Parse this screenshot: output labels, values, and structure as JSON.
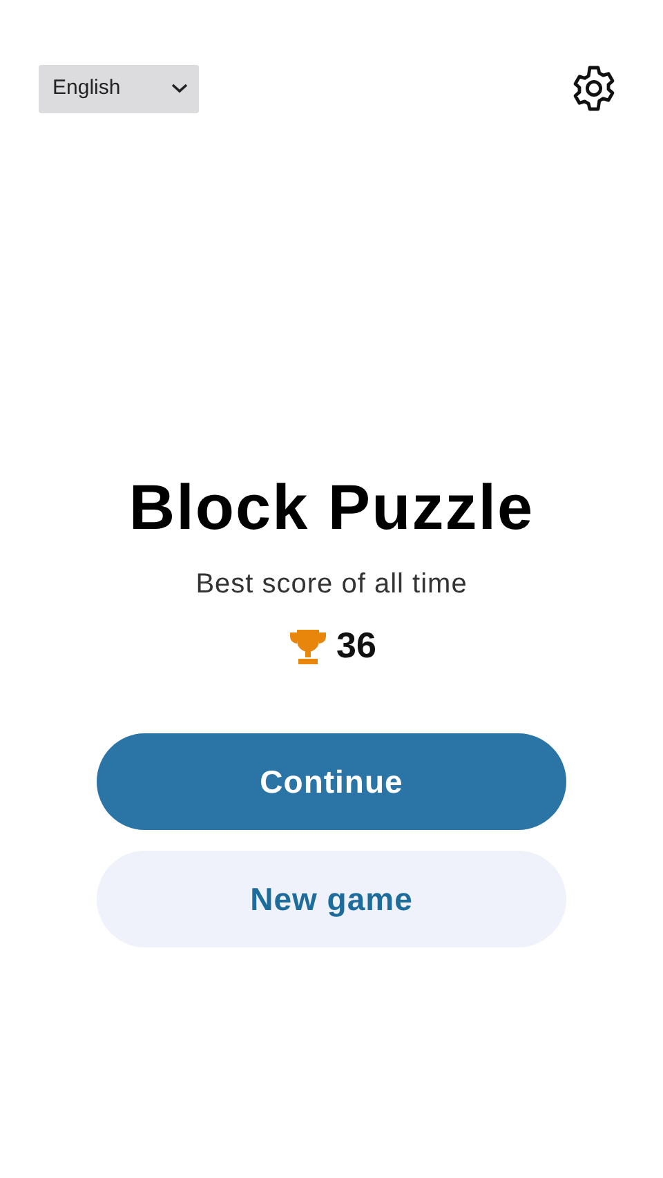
{
  "language_select": {
    "value": "English"
  },
  "title": "Block Puzzle",
  "subtitle": "Best score of all time",
  "best_score": "36",
  "buttons": [
    {
      "label": "Continue",
      "kind": "primary"
    },
    {
      "label": "New game",
      "kind": "secondary"
    }
  ]
}
